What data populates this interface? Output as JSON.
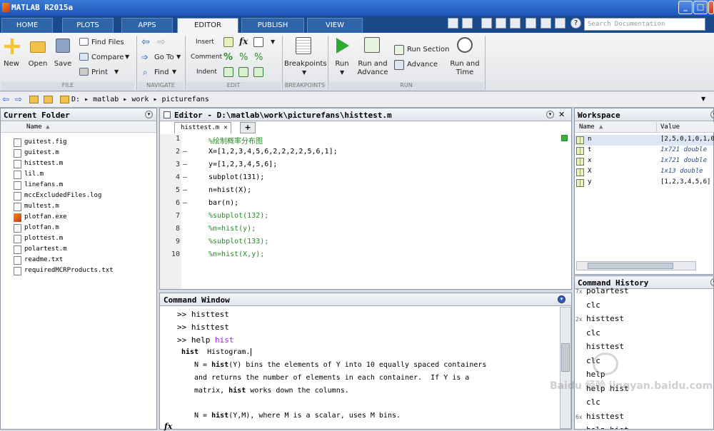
{
  "title": "MATLAB R2015a",
  "tabs": [
    "HOME",
    "PLOTS",
    "APPS",
    "EDITOR",
    "PUBLISH",
    "VIEW"
  ],
  "search_placeholder": "Search Documentation",
  "ribbon": {
    "file": {
      "new": "New",
      "open": "Open",
      "save": "Save",
      "find_files": "Find Files",
      "compare": "Compare",
      "print": "Print",
      "group": "FILE"
    },
    "navigate": {
      "goto": "Go To",
      "find": "Find",
      "group": "NAVIGATE"
    },
    "edit": {
      "insert": "Insert",
      "comment": "Comment",
      "indent": "Indent",
      "fx": "fx",
      "group": "EDIT"
    },
    "breakpoints": {
      "label": "Breakpoints",
      "group": "BREAKPOINTS"
    },
    "run": {
      "run": "Run",
      "run_and_advance_1": "Run and",
      "run_and_advance_2": "Advance",
      "run_section": "Run Section",
      "advance": "Advance",
      "run_and_time_1": "Run and",
      "run_and_time_2": "Time",
      "group": "RUN"
    }
  },
  "address": {
    "path": [
      "D:",
      "matlab",
      "work",
      "picturefans"
    ]
  },
  "current_folder": {
    "title": "Current Folder",
    "col_name": "Name",
    "files": [
      "guitest.fig",
      "guitest.m",
      "histtest.m",
      "lil.m",
      "linefans.m",
      "mccExcludedFiles.log",
      "multest.m",
      "plotfan.exe",
      "plotfan.m",
      "plottest.m",
      "polartest.m",
      "readme.txt",
      "requiredMCRProducts.txt"
    ]
  },
  "editor": {
    "title": "Editor - D:\\matlab\\work\\picturefans\\histtest.m",
    "tab": "histtest.m",
    "add_tab": "+",
    "lines": [
      {
        "n": "1",
        "dash": "",
        "code": "%绘制概率分布图",
        "comment": true
      },
      {
        "n": "2",
        "dash": "—",
        "code": "X=[1,2,3,4,5,6,2,2,2,2,5,6,1];",
        "comment": false
      },
      {
        "n": "3",
        "dash": "—",
        "code": "y=[1,2,3,4,5,6];",
        "comment": false
      },
      {
        "n": "4",
        "dash": "—",
        "code": "subplot(131);",
        "comment": false
      },
      {
        "n": "5",
        "dash": "—",
        "code": "n=hist(X);",
        "comment": false
      },
      {
        "n": "6",
        "dash": "—",
        "code": "bar(n);",
        "comment": false
      },
      {
        "n": "7",
        "dash": "",
        "code": "%subplot(132);",
        "comment": true
      },
      {
        "n": "8",
        "dash": "",
        "code": "%n=hist(y);",
        "comment": true
      },
      {
        "n": "9",
        "dash": "",
        "code": "%subplot(133);",
        "comment": true
      },
      {
        "n": "10",
        "dash": "",
        "code": "%n=hist(X,y);",
        "comment": true
      }
    ]
  },
  "command_window": {
    "title": "Command Window",
    "prompt": ">>",
    "cmd1": "histtest",
    "cmd2": "histtest",
    "cmd3_a": "help",
    "cmd3_b": "hist",
    "help_head_bold": "hist",
    "help_head_rest": "Histogram.",
    "p1_a": "N = ",
    "p1_b": "hist",
    "p1_c": "(Y) bins the elements of Y into 10 equally spaced containers",
    "p2": "and returns the number of elements in each container.  If Y is a",
    "p3_a": "matrix, ",
    "p3_b": "hist",
    "p3_c": " works down the columns.",
    "p4_a": "N = ",
    "p4_b": "hist",
    "p4_c": "(Y,M), where M is a scalar, uses M bins.",
    "fx": "fx"
  },
  "workspace": {
    "title": "Workspace",
    "col_name": "Name",
    "col_value": "Value",
    "rows": [
      {
        "name": "n",
        "value": "[2,5,0,1,0,1,0,"
      },
      {
        "name": "t",
        "value": "1x721 double"
      },
      {
        "name": "x",
        "value": "1x721 double"
      },
      {
        "name": "X",
        "value": "1x13 double"
      },
      {
        "name": "y",
        "value": "[1,2,3,4,5,6]"
      }
    ]
  },
  "history": {
    "title": "Command History",
    "rows": [
      {
        "count": "7x",
        "cmd": "polartest"
      },
      {
        "count": "",
        "cmd": "clc"
      },
      {
        "count": "2x",
        "cmd": "histtest"
      },
      {
        "count": "",
        "cmd": "clc"
      },
      {
        "count": "",
        "cmd": "histtest"
      },
      {
        "count": "",
        "cmd": "clc"
      },
      {
        "count": "",
        "cmd": "help"
      },
      {
        "count": "",
        "cmd": "help hist"
      },
      {
        "count": "",
        "cmd": "clc"
      },
      {
        "count": "6x",
        "cmd": "histtest"
      },
      {
        "count": "",
        "cmd": "help hist"
      }
    ]
  },
  "watermark": "Baidu 经验 jingyan.baidu.com",
  "colors": {
    "accent": "#1b4a8a",
    "comment": "#228b22",
    "keyword": "#a020f0"
  }
}
